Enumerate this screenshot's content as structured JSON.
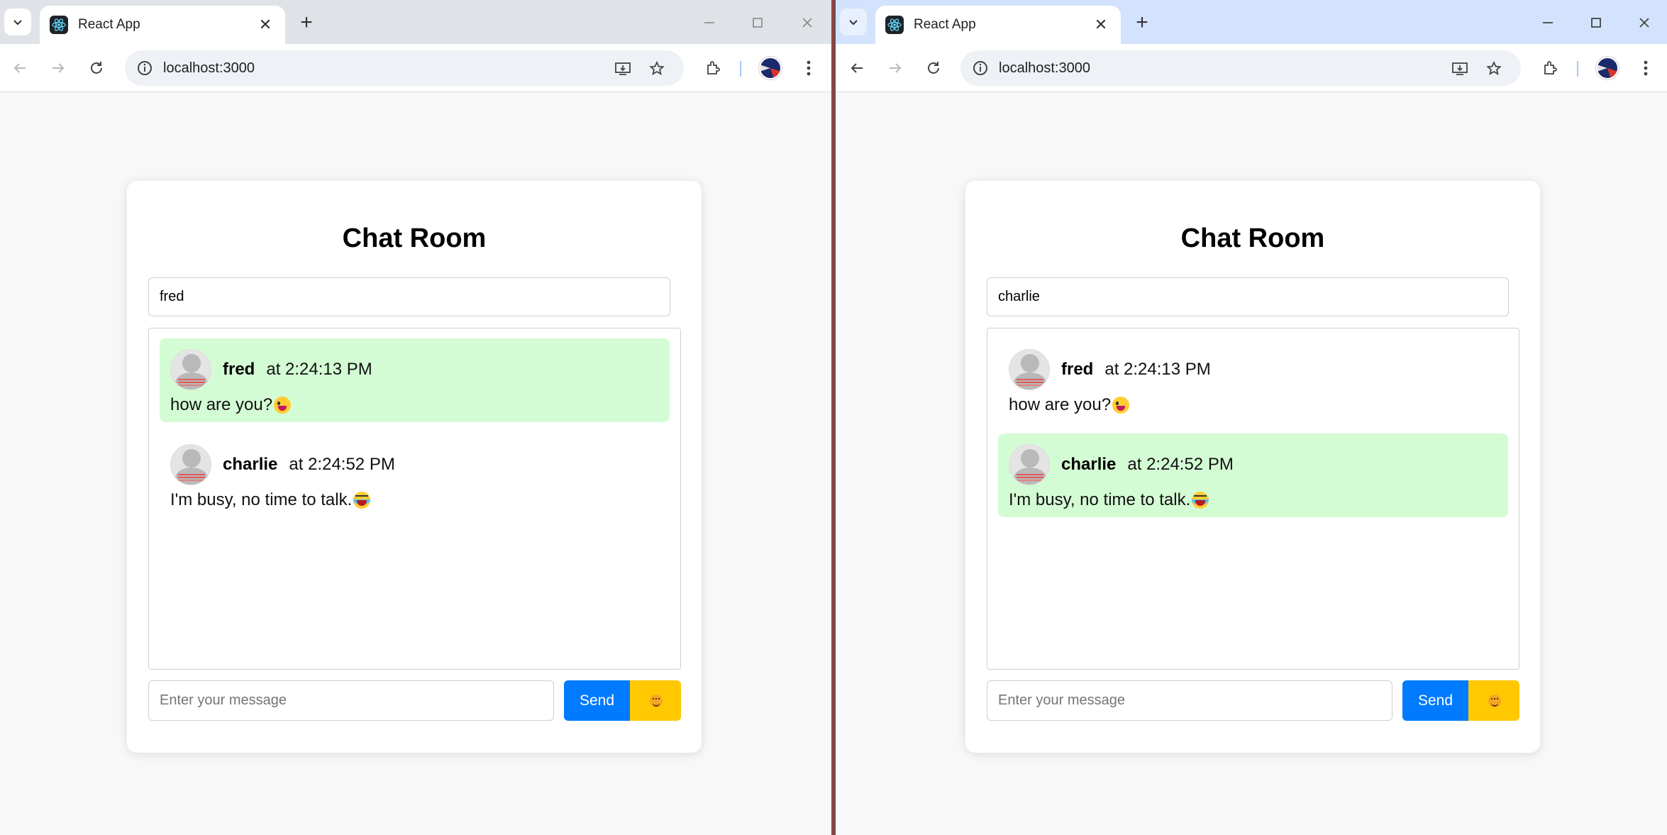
{
  "windows": [
    {
      "tab_title": "React App",
      "url": "localhost:3000",
      "heading": "Chat Room",
      "username_value": "fred",
      "message_placeholder": "Enter your message",
      "send_label": "Send",
      "messages": [
        {
          "user": "fred",
          "time": "at 2:24:13 PM",
          "text": "how are you?",
          "emoji": "winking-tongue-emoji",
          "mine": true
        },
        {
          "user": "charlie",
          "time": "at 2:24:52 PM",
          "text": "I'm busy, no time to talk.",
          "emoji": "tears-of-joy-emoji",
          "mine": false
        }
      ]
    },
    {
      "tab_title": "React App",
      "url": "localhost:3000",
      "heading": "Chat Room",
      "username_value": "charlie",
      "message_placeholder": "Enter your message",
      "send_label": "Send",
      "messages": [
        {
          "user": "fred",
          "time": "at 2:24:13 PM",
          "text": "how are you?",
          "emoji": "winking-tongue-emoji",
          "mine": false
        },
        {
          "user": "charlie",
          "time": "at 2:24:52 PM",
          "text": "I'm busy, no time to talk.",
          "emoji": "tears-of-joy-emoji",
          "mine": true
        }
      ]
    }
  ],
  "colors": {
    "own_message_bg": "#d4fcd4",
    "send_button": "#007bff",
    "emoji_button": "#ffc800"
  },
  "icons": [
    "tab-search-icon",
    "react-favicon-icon",
    "close-icon",
    "new-tab-icon",
    "minimize-icon",
    "maximize-icon",
    "back-icon",
    "forward-icon",
    "reload-icon",
    "site-info-icon",
    "install-app-icon",
    "bookmark-star-icon",
    "extensions-icon",
    "profile-avatar-icon",
    "menu-kebab-icon",
    "smiley-icon"
  ]
}
